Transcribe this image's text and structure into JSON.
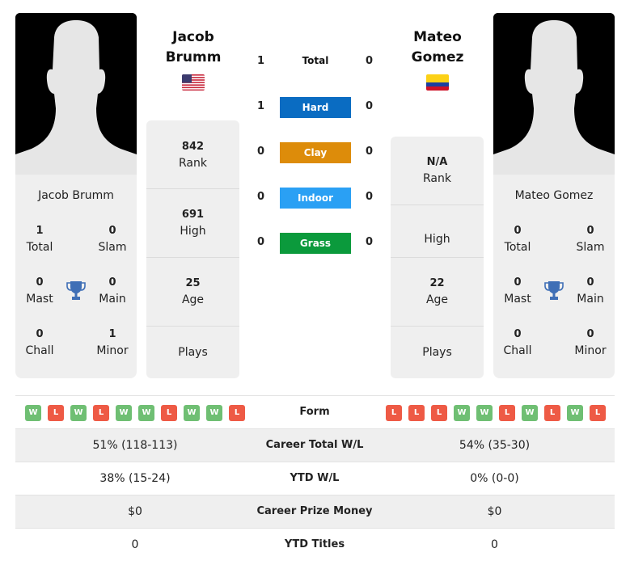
{
  "player_left": {
    "name_line1": "Jacob",
    "name_line2": "Brumm",
    "full_name": "Jacob Brumm",
    "flag": "us-flag",
    "titles": {
      "total": "1",
      "total_label": "Total",
      "slam": "0",
      "slam_label": "Slam",
      "mast": "0",
      "mast_label": "Mast",
      "main": "0",
      "main_label": "Main",
      "chall": "0",
      "chall_label": "Chall",
      "minor": "1",
      "minor_label": "Minor"
    },
    "stats": {
      "rank": "842",
      "rank_label": "Rank",
      "high": "691",
      "high_label": "High",
      "age": "25",
      "age_label": "Age",
      "plays": "",
      "plays_label": "Plays"
    }
  },
  "player_right": {
    "name_line1": "Mateo",
    "name_line2": "Gomez",
    "full_name": "Mateo Gomez",
    "flag": "colombia-flag",
    "titles": {
      "total": "0",
      "total_label": "Total",
      "slam": "0",
      "slam_label": "Slam",
      "mast": "0",
      "mast_label": "Mast",
      "main": "0",
      "main_label": "Main",
      "chall": "0",
      "chall_label": "Chall",
      "minor": "0",
      "minor_label": "Minor"
    },
    "stats": {
      "rank": "N/A",
      "rank_label": "Rank",
      "high": "",
      "high_label": "High",
      "age": "22",
      "age_label": "Age",
      "plays": "",
      "plays_label": "Plays"
    }
  },
  "h2h": {
    "total": {
      "label": "Total",
      "left": "1",
      "right": "0"
    },
    "surfaces": [
      {
        "label": "Hard",
        "left": "1",
        "right": "0",
        "color": "#0a6cc2"
      },
      {
        "label": "Clay",
        "left": "0",
        "right": "0",
        "color": "#dd8c0a"
      },
      {
        "label": "Indoor",
        "left": "0",
        "right": "0",
        "color": "#2aa0f4"
      },
      {
        "label": "Grass",
        "left": "0",
        "right": "0",
        "color": "#0b9a3c"
      }
    ]
  },
  "comparison": {
    "form_label": "Form",
    "form_left": [
      "W",
      "L",
      "W",
      "L",
      "W",
      "W",
      "L",
      "W",
      "W",
      "L"
    ],
    "form_right": [
      "L",
      "L",
      "L",
      "W",
      "W",
      "L",
      "W",
      "L",
      "W",
      "L"
    ],
    "rows": [
      {
        "label": "Career Total W/L",
        "left": "51% (118-113)",
        "right": "54% (35-30)"
      },
      {
        "label": "YTD W/L",
        "left": "38% (15-24)",
        "right": "0% (0-0)"
      },
      {
        "label": "Career Prize Money",
        "left": "$0",
        "right": "$0"
      },
      {
        "label": "YTD Titles",
        "left": "0",
        "right": "0"
      }
    ]
  },
  "colors": {
    "win": "#6fbf73",
    "loss": "#ee5a45",
    "trophy": "#3f6fb6",
    "card_bg": "#efefef"
  }
}
